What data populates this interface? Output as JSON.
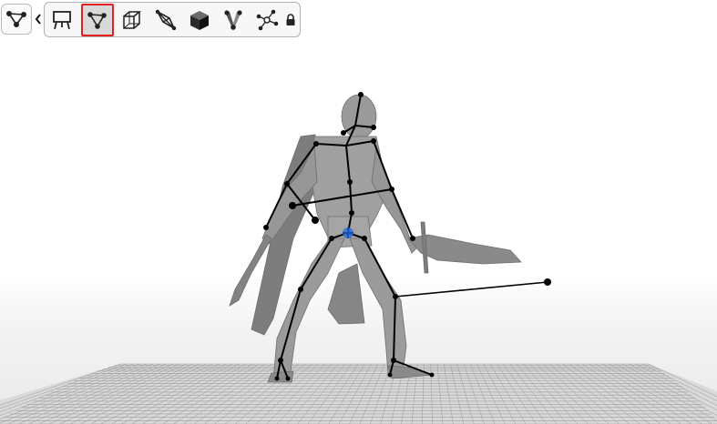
{
  "mode_selector": {
    "icon": "skeleton-icon",
    "arrow_icon": "chevron-left-icon"
  },
  "toolbar": {
    "tools": [
      {
        "id": "easel",
        "icon": "easel-icon",
        "active": false
      },
      {
        "id": "skeleton",
        "icon": "skeleton-icon",
        "active": true
      },
      {
        "id": "wireframe-cube",
        "icon": "wireframe-cube-icon",
        "active": false
      },
      {
        "id": "bone-shape",
        "icon": "bone-shape-icon",
        "active": false
      },
      {
        "id": "solid-cube",
        "icon": "solid-cube-icon",
        "active": false
      },
      {
        "id": "shaded-bones",
        "icon": "shaded-bones-icon",
        "active": false
      },
      {
        "id": "node-graph",
        "icon": "node-graph-icon",
        "active": false
      },
      {
        "id": "lock",
        "icon": "lock-icon",
        "active": false
      }
    ]
  },
  "colors": {
    "active_outline": "#e32020",
    "bone": "#000000",
    "mesh": "#8e8e8e",
    "grid": "#9a9a9a",
    "root_marker": "#2f6fd6"
  }
}
